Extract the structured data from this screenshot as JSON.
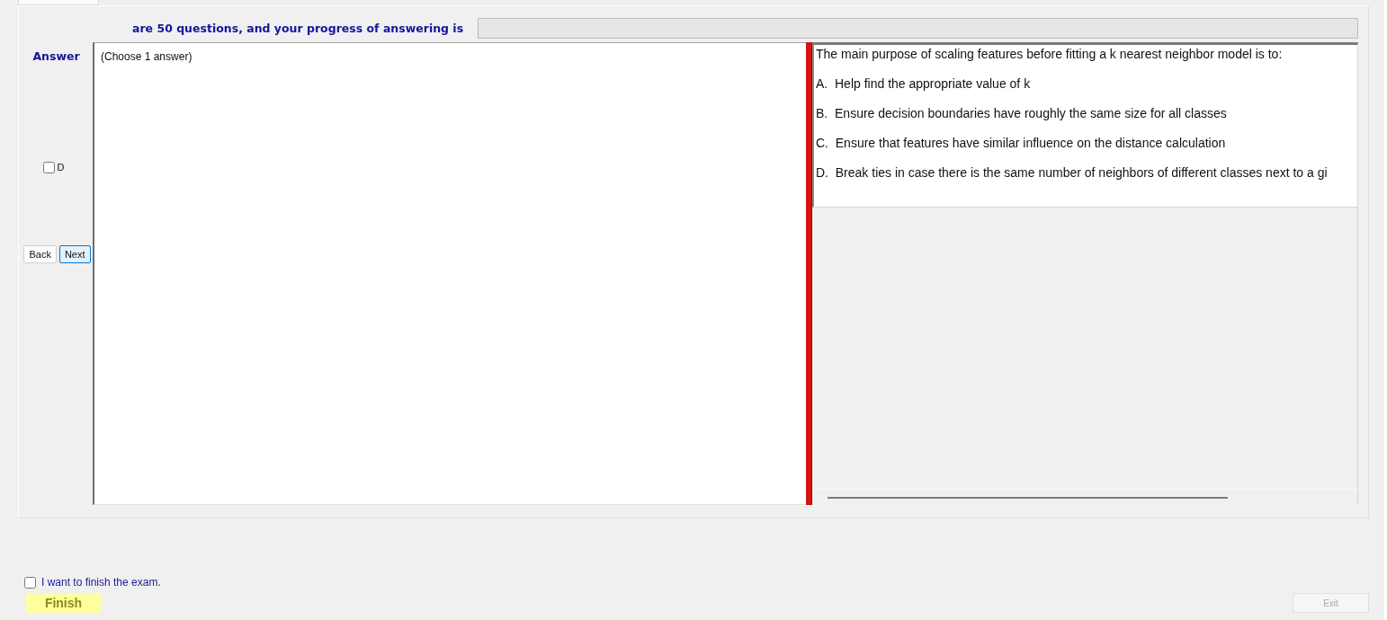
{
  "header": {
    "caption": "are 50 questions, and your progress of answering is",
    "progress": {
      "level": 0
    }
  },
  "answer_panel": {
    "heading": "Answer",
    "options": [
      {
        "label": "D",
        "checked": false
      }
    ],
    "buttons": [
      {
        "label": "Back",
        "focused": false
      },
      {
        "label": "Next",
        "focused": true
      }
    ],
    "instruction": "(Choose 1 answer)"
  },
  "question": {
    "text": "The main purpose of scaling features before fitting a k nearest neighbor model is to:",
    "choices": [
      "A.  Help find the appropriate value of k",
      "B.  Ensure decision boundaries have roughly the same size for all classes",
      "C.  Ensure that features have similar influence on the distance calculation",
      "D.  Break ties in case there is the same number of neighbors of different classes next to a gi"
    ]
  },
  "footer": {
    "confirm": {
      "label": "I want to finish the exam.",
      "checked": false
    },
    "finish_button": {
      "label": "Finish"
    },
    "exit_button": {
      "label": "Exit",
      "disabled": true
    }
  }
}
